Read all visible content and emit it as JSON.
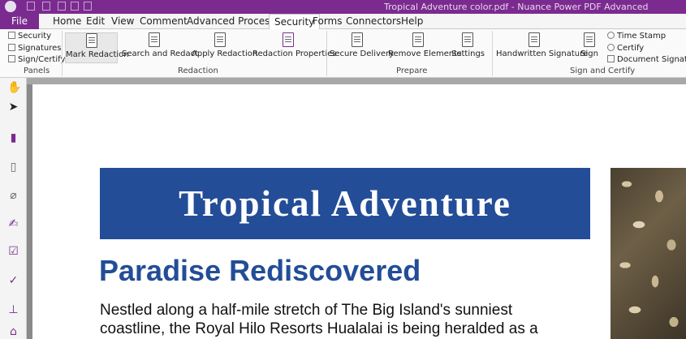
{
  "titlebar": {
    "title": "Tropical Adventure color.pdf - Nuance Power PDF Advanced"
  },
  "menu": {
    "tabs": [
      "File",
      "Home",
      "Edit",
      "View",
      "Comment",
      "Advanced Processing",
      "Security",
      "Forms",
      "Connectors",
      "Help"
    ],
    "active": "Security"
  },
  "ribbon": {
    "panels_group": {
      "items": [
        "Security",
        "Signatures",
        "Sign/Certify"
      ],
      "label": "Panels"
    },
    "redaction_group": {
      "buttons": [
        "Mark Redaction",
        "Search and Redact",
        "Apply Redaction",
        "Redaction Properties"
      ],
      "label": "Redaction"
    },
    "prepare_group": {
      "buttons": [
        "Secure Delivery",
        "Remove Elements",
        "Settings"
      ],
      "label": "Prepare"
    },
    "sign_group": {
      "buttons": [
        "Handwritten Signature",
        "Sign"
      ],
      "small": [
        "Time Stamp",
        "Certify",
        "Document Signatures"
      ],
      "label": "Sign and Certify"
    }
  },
  "sidebar": {
    "icons": [
      "hand-tool-icon",
      "select-arrow-icon",
      "bookmark-icon",
      "page-icon",
      "attachment-icon",
      "signature-icon",
      "checkbox-icon",
      "checkmark-icon",
      "stamp-icon",
      "lock-icon"
    ]
  },
  "document": {
    "banner_title": "Tropical Adventure",
    "subtitle": "Paradise Rediscovered",
    "body_line_1": "Nestled along a half-mile stretch of The Big Island's sunniest",
    "body_line_2": "coastline, the Royal Hilo Resorts Hualalai is being heralded as a"
  },
  "colors": {
    "brand": "#7b2b8f",
    "banner": "#234d97",
    "subtitle": "#234d97"
  }
}
